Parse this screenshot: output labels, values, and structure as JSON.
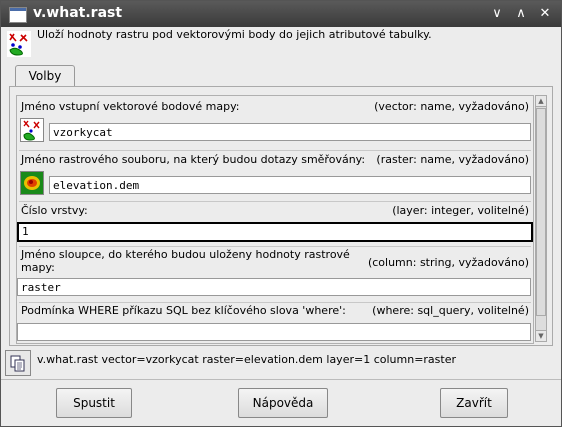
{
  "window": {
    "title": "v.what.rast"
  },
  "description": "Uloží hodnoty rastru pod vektorovými body do jejich atributové tabulky.",
  "tabs": [
    {
      "label": "Volby"
    }
  ],
  "fields": [
    {
      "label": "Jméno vstupní vektorové bodové mapy:",
      "hint": "(vector:  name, vyžadováno)",
      "value": "vzorkycat"
    },
    {
      "label": "Jméno rastrového souboru, na který budou dotazy směřovány:",
      "hint": "(raster:  name, vyžadováno)",
      "value": "elevation.dem"
    },
    {
      "label": "Číslo vrstvy:",
      "hint": "(layer:  integer, volitelné)",
      "value": "1"
    },
    {
      "label_line1": "Jméno sloupce, do kterého budou uloženy hodnoty rastrové",
      "label_line2": "mapy:",
      "hint": "(column:  string, vyžadováno)",
      "value": "raster"
    },
    {
      "label": "Podmínka WHERE příkazu SQL bez klíčového slova 'where':",
      "hint": "(where:  sql_query, volitelné)",
      "value": ""
    }
  ],
  "command": "v.what.rast vector=vzorkycat raster=elevation.dem layer=1 column=raster",
  "buttons": {
    "run": "Spustit",
    "help": "Nápověda",
    "close": "Zavřít"
  },
  "titlebar_buttons": {
    "minimize": "∨",
    "maximize": "∧",
    "close": "✕"
  }
}
